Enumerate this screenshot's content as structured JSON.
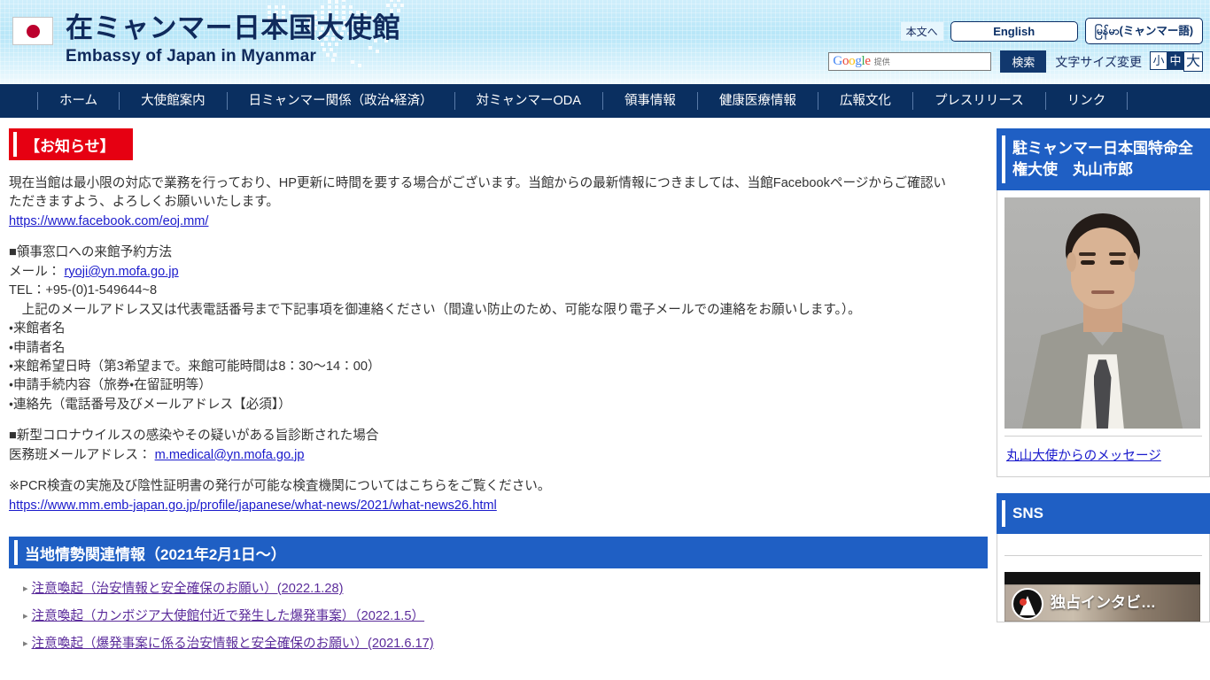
{
  "header": {
    "flag_icon": "japan-flag-icon",
    "title_jp": "在ミャンマー日本国大使館",
    "title_en": "Embassy of Japan in Myanmar",
    "skip_link": "本文へ",
    "lang_english": "English",
    "lang_myanmar": "မြန်မာ(ミャンマー語)",
    "search": {
      "google_letters": [
        "G",
        "o",
        "o",
        "g",
        "l",
        "e"
      ],
      "provided_by": "提供",
      "placeholder": "",
      "value": "",
      "button_label": "検索"
    },
    "fontsize": {
      "label": "文字サイズ変更",
      "small": "小",
      "medium": "中",
      "large": "大",
      "selected": "中"
    }
  },
  "nav": {
    "items": [
      {
        "label": "ホーム"
      },
      {
        "label": "大使館案内"
      },
      {
        "label": "日ミャンマー関係（政治・経済）"
      },
      {
        "label": "対ミャンマーODA"
      },
      {
        "label": "領事情報"
      },
      {
        "label": "健康医療情報"
      },
      {
        "label": "広報文化"
      },
      {
        "label": "プレスリリース"
      },
      {
        "label": "リンク"
      }
    ]
  },
  "main": {
    "notice_heading": "【お知らせ】",
    "paragraphs": {
      "intro_line1": "現在当館は最小限の対応で業務を行っており、HP更新に時間を要する場合がございます。当館からの最新情報につきましては、当館Facebookページからご確認い",
      "intro_line2": "ただきますよう、よろしくお願いいたします。",
      "facebook_url": "https://www.facebook.com/eoj.mm/",
      "consular_heading": "■領事窓口への来館予約方法",
      "mail_label": "メール：",
      "mail_address": "ryoji@yn.mofa.go.jp",
      "tel_line": "TEL：+95-(0)1-549644~8",
      "instruction": "　上記のメールアドレス又は代表電話番号まで下記事項を御連絡ください（間違い防止のため、可能な限り電子メールでの連絡をお願いします。）。",
      "bullet1": "・来館者名",
      "bullet2": "・申請者名",
      "bullet3": "・来館希望日時（第3希望まで。来館可能時間は8：30〜14：00）",
      "bullet4": "・申請手続内容（旅券・在留証明等）",
      "bullet5": "・連絡先（電話番号及びメールアドレス【必須】）",
      "covid_heading": "■新型コロナウイルスの感染やその疑いがある旨診断された場合",
      "medical_label": "医務班メールアドレス：",
      "medical_address": "m.medical@yn.mofa.go.jp",
      "pcr_note": "※PCR検査の実施及び陰性証明書の発行が可能な検査機関についてはこちらをご覧ください。",
      "pcr_url": "https://www.mm.emb-japan.go.jp/profile/japanese/what-news/2021/what-news26.html"
    },
    "section_heading": "当地情勢関連情報（2021年2月1日〜）",
    "links": [
      {
        "label": "注意喚起（治安情報と安全確保のお願い）(2022.1.28)"
      },
      {
        "label": "注意喚起（カンボジア大使館付近で発生した爆発事案）（2022.1.5）"
      },
      {
        "label": "注意喚起（爆発事案に係る治安情報と安全確保のお願い）(2021.6.17)"
      }
    ]
  },
  "sidebar": {
    "ambassador": {
      "heading": "駐ミャンマー日本国特命全権大使　丸山市郎",
      "photo_alt": "ambassador-portrait",
      "message_link": "丸山大使からのメッセージ"
    },
    "sns": {
      "heading": "SNS",
      "video_title": "独占インタビ…",
      "video_logo": "embassy-logo-icon"
    }
  },
  "colors": {
    "nav_blue": "#0a2f60",
    "section_blue": "#1f5fc4",
    "notice_red": "#e60012",
    "link_blue": "#1a1acc",
    "link_visited": "#5b2c9b",
    "header_gradient_top": "#cfeefb"
  }
}
